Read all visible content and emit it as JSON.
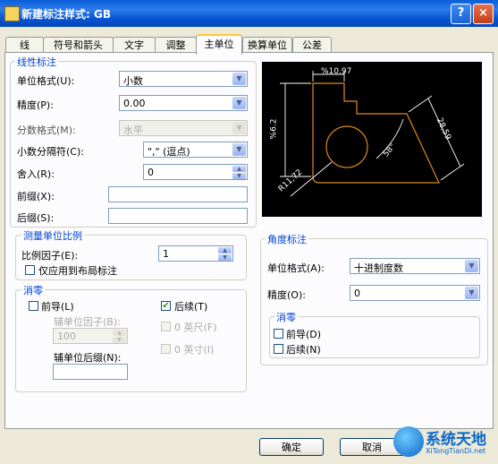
{
  "window": {
    "title": "新建标注样式: GB",
    "help_glyph": "?",
    "close_glyph": "×"
  },
  "tabs": [
    {
      "label": "线"
    },
    {
      "label": "符号和箭头"
    },
    {
      "label": "文字"
    },
    {
      "label": "调整"
    },
    {
      "label": "主单位"
    },
    {
      "label": "换算单位"
    },
    {
      "label": "公差"
    }
  ],
  "linear": {
    "group_title": "线性标注",
    "unit_format_label": "单位格式(U):",
    "unit_format_value": "小数",
    "precision_label": "精度(P):",
    "precision_value": "0.00",
    "fraction_format_label": "分数格式(M):",
    "fraction_format_value": "水平",
    "decimal_sep_label": "小数分隔符(C):",
    "decimal_sep_value": "\",\"  (逗点)",
    "roundoff_label": "舍入(R):",
    "roundoff_value": "0",
    "prefix_label": "前缀(X):",
    "prefix_value": "",
    "suffix_label": "后缀(S):",
    "suffix_value": ""
  },
  "scale": {
    "group_title": "测量单位比例",
    "factor_label": "比例因子(E):",
    "factor_value": "1",
    "layout_only_label": "仅应用到布局标注",
    "layout_only_checked": false
  },
  "zero_suppression": {
    "group_title": "消零",
    "leading_label": "前导(L)",
    "leading_checked": false,
    "trailing_label": "后续(T)",
    "trailing_checked": true,
    "sub_factor_label": "辅单位因子(B):",
    "sub_factor_value": "100",
    "sub_suffix_label": "辅单位后缀(N):",
    "sub_suffix_value": "",
    "feet_label": "0 英尺(F)",
    "inches_label": "0 英寸(I)"
  },
  "angular": {
    "group_title": "角度标注",
    "unit_format_label": "单位格式(A):",
    "unit_format_value": "十进制度数",
    "precision_label": "精度(O):",
    "precision_value": "0",
    "zero_title": "消零",
    "leading_label": "前导(D)",
    "trailing_label": "后续(N)"
  },
  "preview": {
    "dim_top": "%10.97",
    "dim_left": "%6.2",
    "dim_right": "28,59",
    "dim_radius": "R11,72",
    "dim_angle": "58°"
  },
  "buttons": {
    "ok": "确定",
    "cancel": "取消"
  },
  "watermark": {
    "text": "系统天地",
    "url": "XiTongTianDi.net"
  }
}
